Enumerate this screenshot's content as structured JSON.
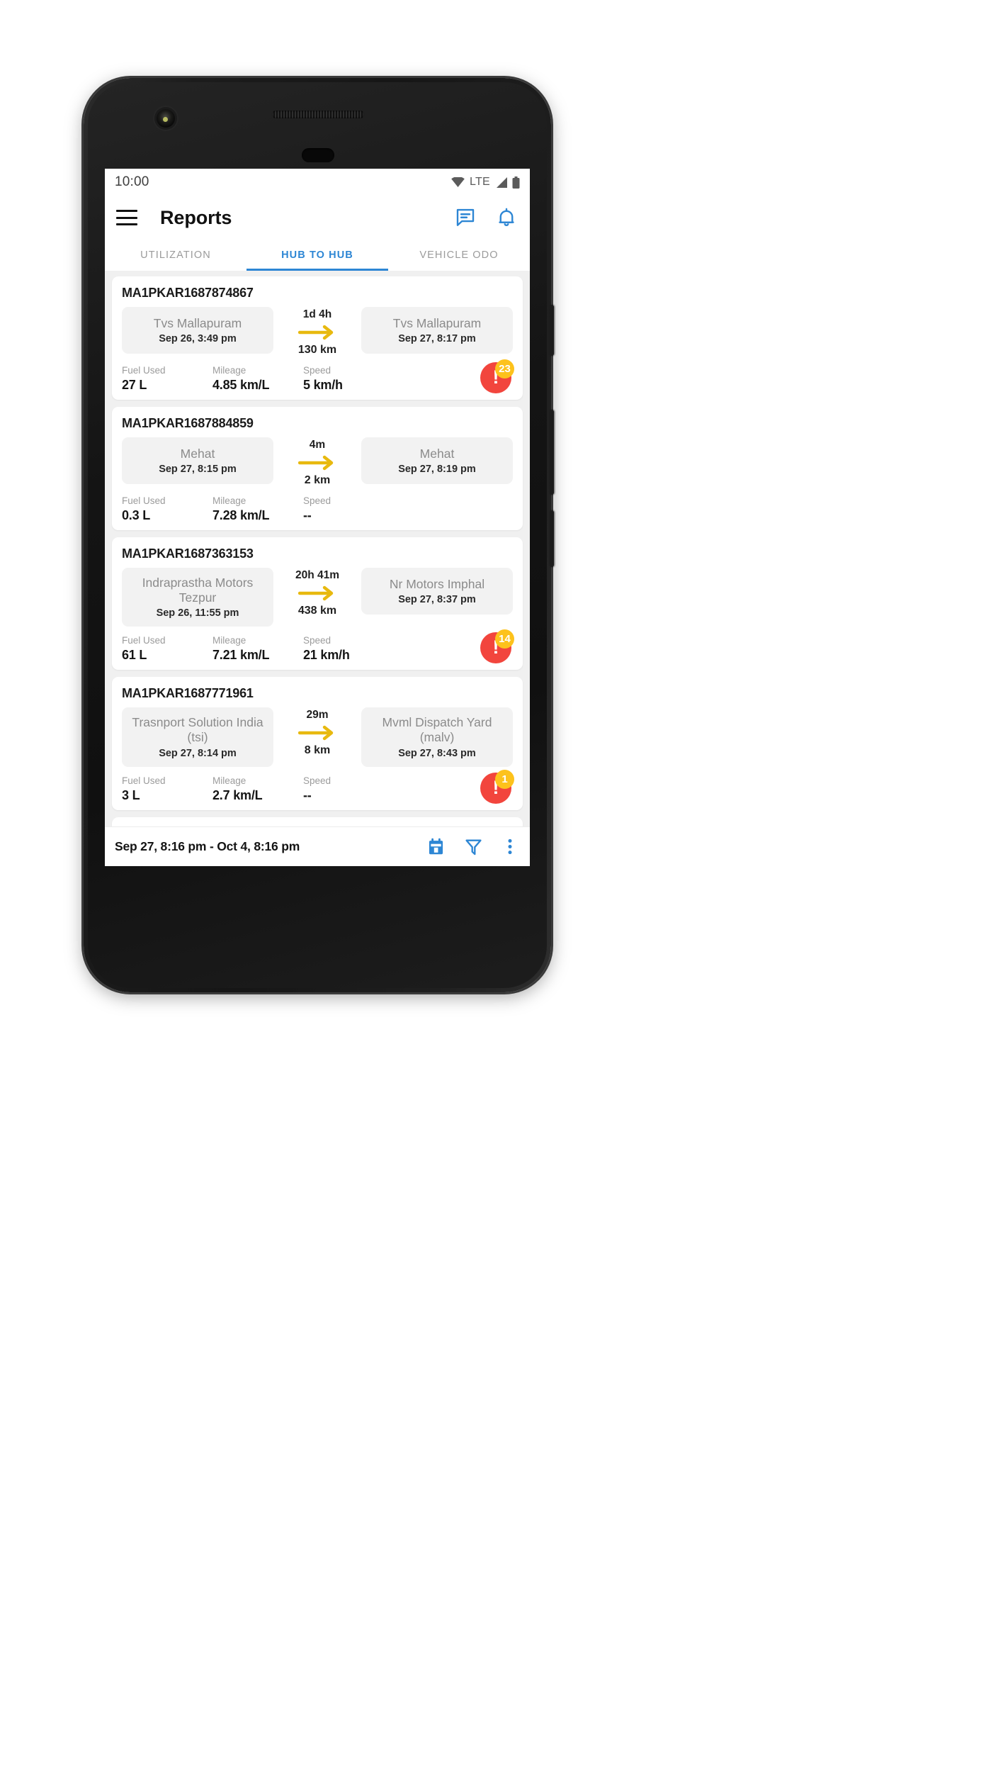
{
  "status_bar": {
    "time": "10:00",
    "network_label": "LTE",
    "icons": [
      "wifi-icon",
      "signal-icon",
      "battery-icon"
    ]
  },
  "app_bar": {
    "menu_icon": "hamburger-menu-icon",
    "title": "Reports",
    "chat_icon": "chat-icon",
    "notification_icon": "bell-icon",
    "icon_color": "#2D86D4"
  },
  "tabs": {
    "items": [
      {
        "label": "UTILIZATION",
        "active": false
      },
      {
        "label": "HUB TO HUB",
        "active": true
      },
      {
        "label": "VEHICLE ODO",
        "active": false
      }
    ],
    "active_color": "#2D86D4",
    "inactive_color": "#9b9b9b"
  },
  "stat_labels": {
    "fuel": "Fuel Used",
    "mileage": "Mileage",
    "speed": "Speed"
  },
  "colors": {
    "arrow": "#E8B90F",
    "alert_circle": "#F2453D",
    "alert_badge": "#FDC21C",
    "list_background": "#f0f0f0",
    "chip_background": "#f2f2f2"
  },
  "trips": [
    {
      "id": "MA1PKAR1687874867",
      "origin_name": "Tvs Mallapuram",
      "origin_time": "Sep 26, 3:49 pm",
      "duration": "1d 4h",
      "distance": "130 km",
      "dest_name": "Tvs Mallapuram",
      "dest_time": "Sep 27, 8:17 pm",
      "fuel_used": "27 L",
      "mileage": "4.85 km/L",
      "speed": "5 km/h",
      "alert_count": "23"
    },
    {
      "id": "MA1PKAR1687884859",
      "origin_name": "Mehat",
      "origin_time": "Sep 27, 8:15 pm",
      "duration": "4m",
      "distance": "2 km",
      "dest_name": "Mehat",
      "dest_time": "Sep 27, 8:19 pm",
      "fuel_used": "0.3 L",
      "mileage": "7.28 km/L",
      "speed": "--",
      "alert_count": ""
    },
    {
      "id": "MA1PKAR1687363153",
      "origin_name": "Indraprastha Motors Tezpur",
      "origin_time": "Sep 26, 11:55 pm",
      "duration": "20h 41m",
      "distance": "438 km",
      "dest_name": "Nr Motors Imphal",
      "dest_time": "Sep 27, 8:37 pm",
      "fuel_used": "61 L",
      "mileage": "7.21 km/L",
      "speed": "21 km/h",
      "alert_count": "14"
    },
    {
      "id": "MA1PKAR1687771961",
      "origin_name": "Trasnport Solution India (tsi)",
      "origin_time": "Sep 27, 8:14 pm",
      "duration": "29m",
      "distance": "8 km",
      "dest_name": "Mvml Dispatch Yard (malv)",
      "dest_time": "Sep 27, 8:43 pm",
      "fuel_used": "3 L",
      "mileage": "2.7 km/L",
      "speed": "--",
      "alert_count": "1"
    }
  ],
  "bottom_bar": {
    "date_range": "Sep 27, 8:16 pm - Oct 4, 8:16 pm",
    "calendar_icon": "calendar-icon",
    "filter_icon": "filter-icon",
    "more_icon": "more-vertical-icon"
  },
  "nav_bar": {
    "back": "back-icon",
    "home": "home-icon",
    "recents": "recents-icon"
  }
}
